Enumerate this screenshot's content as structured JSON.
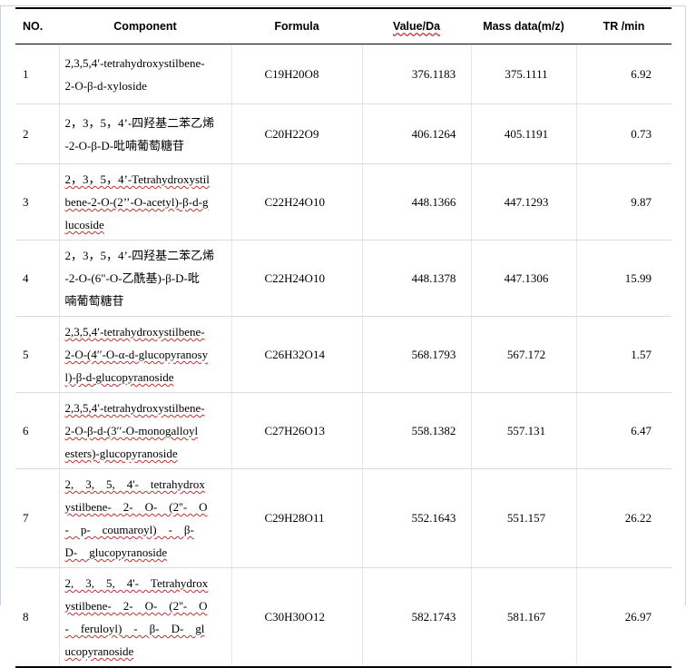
{
  "header": {
    "no": "NO.",
    "component": "Component",
    "formula": "Formula",
    "value": "Value/Da",
    "mass": "Mass data(m/z)",
    "tr": "TR /min"
  },
  "rows": [
    {
      "no": "1",
      "component": [
        "2,3,5,4′-tetrahydroxystilbene-",
        "2-O-β-d-xyloside"
      ],
      "formula": "C19H20O8",
      "value": "376.1183",
      "mass": "375.1111",
      "tr": "6.92"
    },
    {
      "no": "2",
      "component": [
        "2，3，5，4’-四羟基二苯乙烯",
        "-2-O-β-D-吡喃葡萄糖苷"
      ],
      "formula": "C20H22O9",
      "value": "406.1264",
      "mass": "405.1191",
      "tr": "0.73"
    },
    {
      "no": "3",
      "component": [
        "2，3，5，4’-Tetrahydroxystil",
        "bene-2-O-(2’’-O-acetyl)-β-d-g",
        "lucoside"
      ],
      "formula": "C22H24O10",
      "value": "448.1366",
      "mass": "447.1293",
      "tr": "9.87"
    },
    {
      "no": "4",
      "component": [
        "2，3，5，4’-四羟基二苯乙烯",
        "-2-O-(6\"-O-乙酰基)-β-D-吡",
        "喃葡萄糖苷"
      ],
      "formula": "C22H24O10",
      "value": "448.1378",
      "mass": "447.1306",
      "tr": "15.99"
    },
    {
      "no": "5",
      "component": [
        "2,3,5,4′-tetrahydroxystilbene-",
        "2-O-(4′′-O-α-d-glucopyranosy",
        "l)-β-d-glucopyranoside"
      ],
      "formula": "C26H32O14",
      "value": "568.1793",
      "mass": "567.172",
      "tr": "1.57"
    },
    {
      "no": "6",
      "component": [
        "2,3,5,4′-tetrahydroxystilbene-",
        "2-O-β-d-(3′′-O-monogalloyl",
        "esters)-glucopyranoside"
      ],
      "formula": "C27H26O13",
      "value": "558.1382",
      "mass": "557.131",
      "tr": "6.47"
    },
    {
      "no": "7",
      "component": [
        "2,　3,　5,　4'-　tetrahydrox",
        "ystilbene-　2-　O-　(2''-　O",
        "-　p-　coumaroyl)　-　β-",
        "D-　glucopyranoside"
      ],
      "formula": "C29H28O11",
      "value": "552.1643",
      "mass": "551.157",
      "tr": "26.22"
    },
    {
      "no": "8",
      "component": [
        "2,　3,　5,　4'-　Tetrahydrox",
        "ystilbene-　2-　O-　(2''-　O",
        "-　feruloyl)　-　β-　D-　gl",
        "ucopyranoside"
      ],
      "formula": "C30H30O12",
      "value": "582.1743",
      "mass": "581.167",
      "tr": "26.97"
    }
  ]
}
